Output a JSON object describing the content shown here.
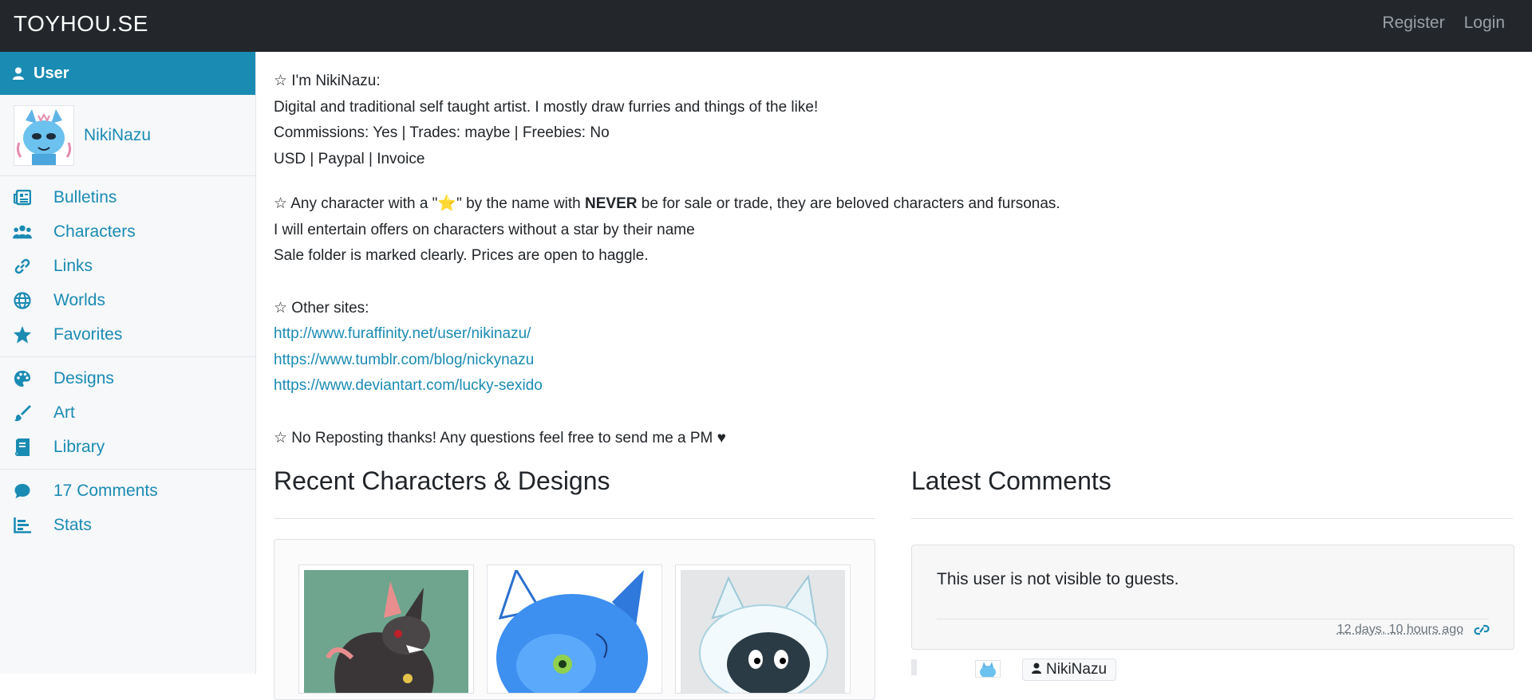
{
  "navbar": {
    "brand": "TOYHOU.SE",
    "register_label": "Register",
    "login_label": "Login"
  },
  "sidebar": {
    "header_label": "User",
    "username": "NikiNazu",
    "groups": [
      [
        {
          "label": "Bulletins",
          "icon": "newspaper-icon"
        },
        {
          "label": "Characters",
          "icon": "users-icon"
        },
        {
          "label": "Links",
          "icon": "link-icon"
        },
        {
          "label": "Worlds",
          "icon": "globe-icon"
        },
        {
          "label": "Favorites",
          "icon": "star-icon"
        }
      ],
      [
        {
          "label": "Designs",
          "icon": "palette-icon"
        },
        {
          "label": "Art",
          "icon": "paintbrush-icon"
        },
        {
          "label": "Library",
          "icon": "book-icon"
        }
      ],
      [
        {
          "label": "17 Comments",
          "icon": "comment-icon"
        },
        {
          "label": "Stats",
          "icon": "chart-icon"
        }
      ]
    ]
  },
  "profile": {
    "line1": "☆ I'm NikiNazu:",
    "line2": "Digital and traditional self taught artist. I mostly draw furries and things of the like!",
    "line3": "Commissions: Yes | Trades: maybe | Freebies: No",
    "line4": "USD | Paypal | Invoice",
    "line5_a": "☆ Any character with a \"⭐\" by the name with ",
    "line5_bold": "NEVER",
    "line5_b": " be for sale or trade, they are beloved characters and fursonas.",
    "line6": "I will entertain offers on characters without a star by their name",
    "line7": "Sale folder is marked clearly. Prices are open to haggle.",
    "other_sites_label": "☆ Other sites:",
    "links": [
      "http://www.furaffinity.net/user/nikinazu/",
      "https://www.tumblr.com/blog/nickynazu",
      "https://www.deviantart.com/lucky-sexido"
    ],
    "closing": "☆ No Reposting thanks! Any questions feel free to send me a PM ♥"
  },
  "recent": {
    "title": "Recent Characters & Designs"
  },
  "comments": {
    "title": "Latest Comments",
    "notice": "This user is not visible to guests.",
    "timestamp": "12 days, 10 hours ago",
    "reply_user": "NikiNazu"
  },
  "colors": {
    "navbar": "#23272b",
    "accent": "#1a8bb3",
    "sidebar_bg": "#f7f8fa"
  }
}
